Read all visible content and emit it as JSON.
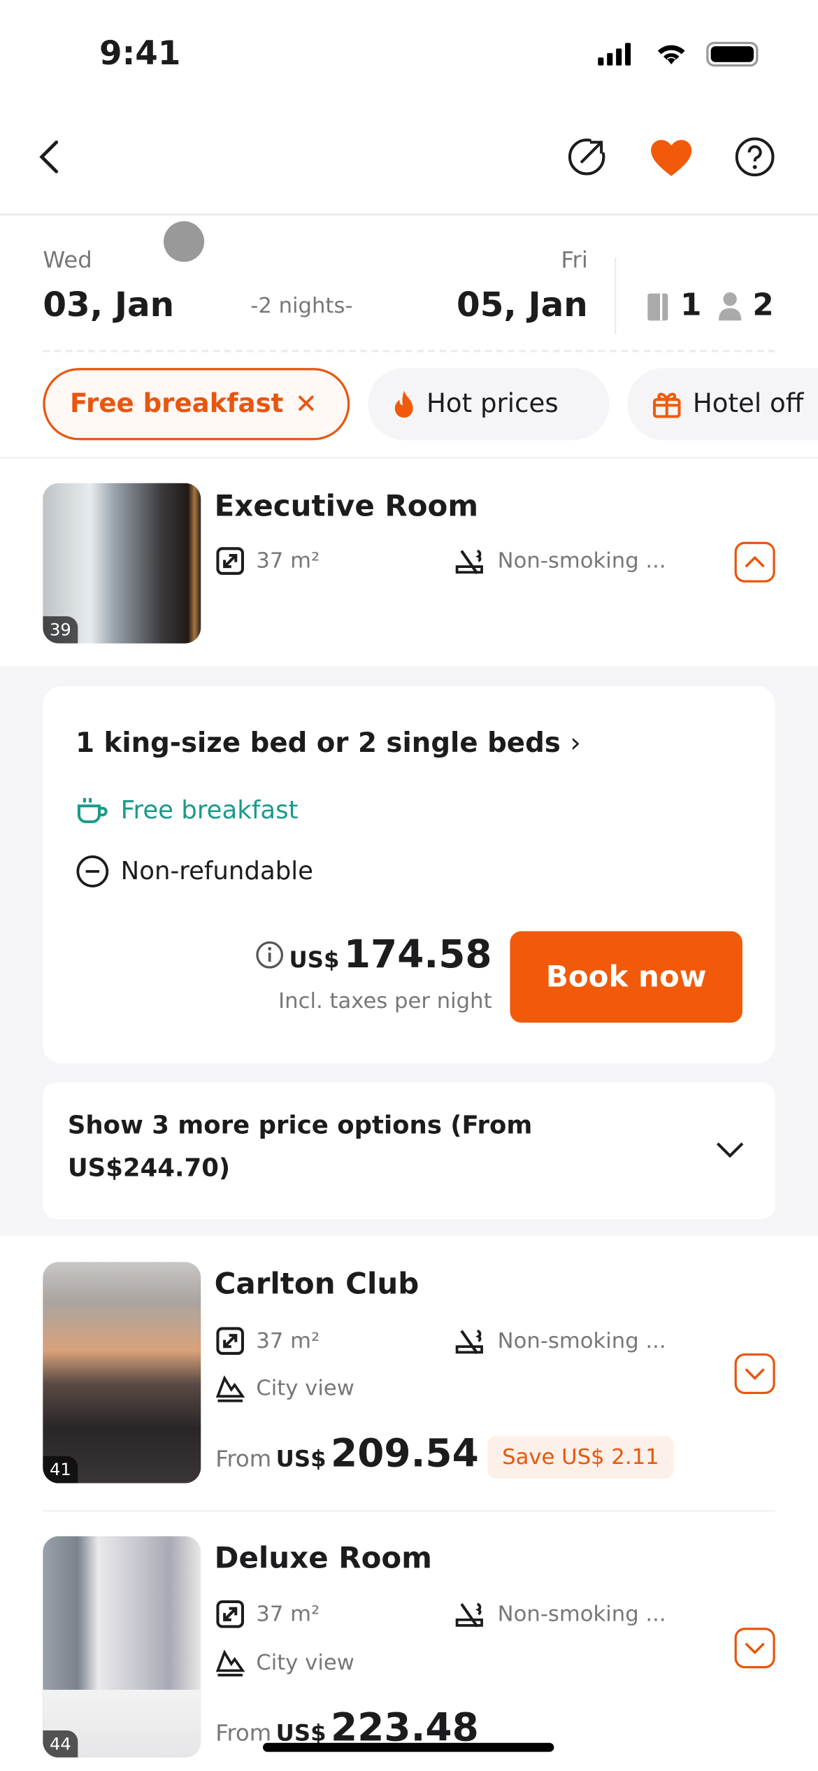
{
  "status": {
    "time": "9:41"
  },
  "colors": {
    "accent": "#e8560e",
    "teal": "#1a9a8a",
    "bg": "#f5f5f8"
  },
  "dates": {
    "checkin_day": "Wed",
    "checkin_date": "03, Jan",
    "nights": "-2 nights-",
    "checkout_day": "Fri",
    "checkout_date": "05, Jan",
    "rooms": "1",
    "guests": "2"
  },
  "filters": [
    {
      "label": "Free breakfast",
      "active": true,
      "icon": "close-icon"
    },
    {
      "label": "Hot prices",
      "icon": "fire-icon"
    },
    {
      "label": "Hotel off",
      "icon": "gift-icon"
    }
  ],
  "rooms": [
    {
      "name": "Executive Room",
      "photo_count": "39",
      "size": "37 m²",
      "smoking": "Non-smoking ...",
      "expanded": true
    },
    {
      "name": "Carlton Club",
      "photo_count": "41",
      "size": "37 m²",
      "smoking": "Non-smoking ...",
      "view": "City view",
      "from": "From",
      "currency": "US$",
      "price": "209.54",
      "save": "Save US$ 2.11"
    },
    {
      "name": "Deluxe Room",
      "photo_count": "44",
      "size": "37 m²",
      "smoking": "Non-smoking ...",
      "view": "City view",
      "from": "From",
      "currency": "US$",
      "price": "223.48"
    }
  ],
  "offer": {
    "bed": "1 king-size bed or 2 single beds",
    "breakfast": "Free breakfast",
    "refund": "Non-refundable",
    "currency": "US$",
    "price": "174.58",
    "price_note": "Incl. taxes per night",
    "book": "Book now"
  },
  "more_options": {
    "line1": "Show 3 more price options (From",
    "line2": "US$244.70)"
  }
}
